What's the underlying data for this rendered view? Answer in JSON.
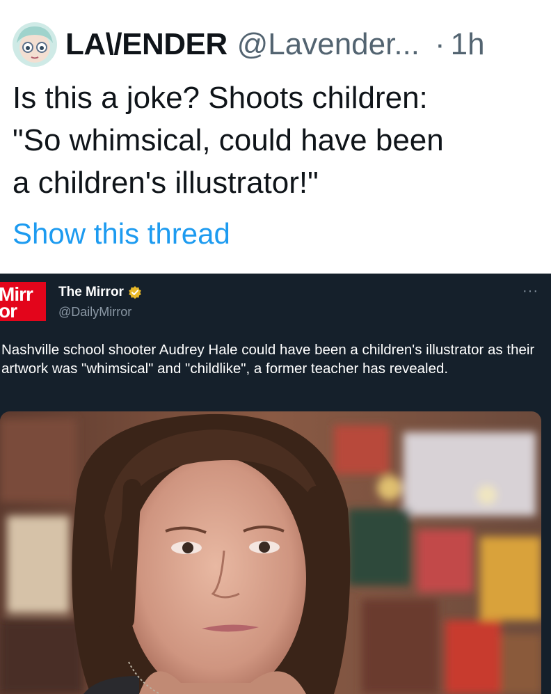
{
  "tweet": {
    "display_name": "LA\\/ENDER",
    "handle": "@Lavender...",
    "separator": "·",
    "time": "1h",
    "text": "Is this a joke? Shoots children:\n\"So whimsical, could have been\na children's illustrator!\"",
    "show_thread": "Show this thread"
  },
  "embed": {
    "logo_line1": "Mirr",
    "logo_line2": "or",
    "name": "The Mirror",
    "handle": "@DailyMirror",
    "more": "···",
    "text": "Nashville school shooter Audrey Hale could have been a children's illustrator as their artwork was \"whimsical\" and \"childlike\", a former teacher has revealed.",
    "photo_icon": "portrait-photo"
  },
  "colors": {
    "link": "#1d9bf0",
    "embed_bg": "#15202b",
    "mirror_red": "#e3051b",
    "verified_gold": "#e8b828"
  }
}
